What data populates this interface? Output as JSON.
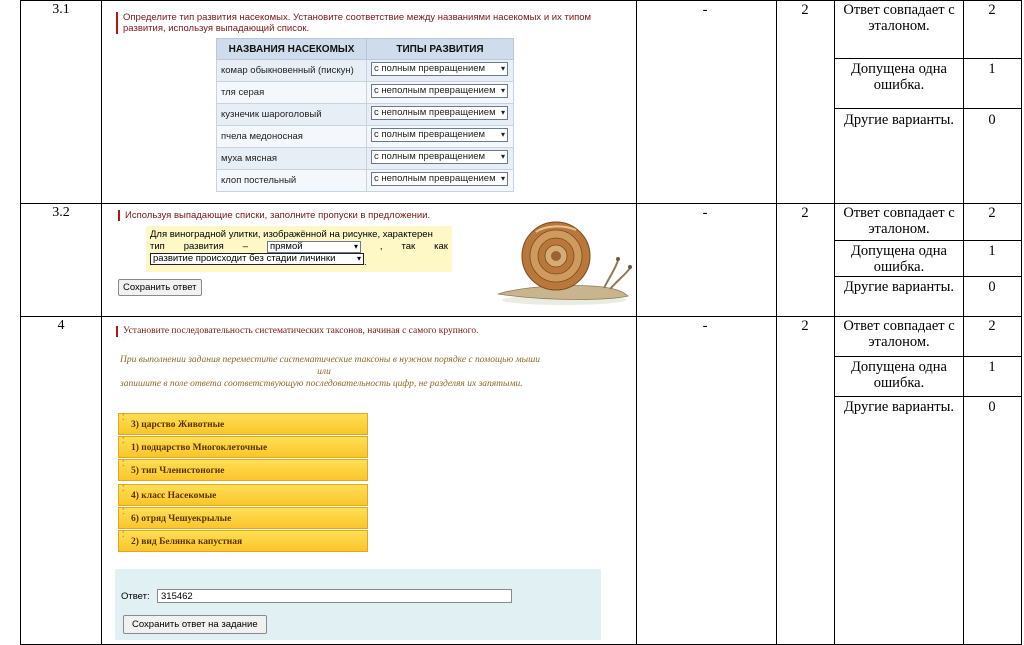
{
  "rows": [
    {
      "num": "3.1",
      "dash": "-",
      "points": "2",
      "criteria": [
        {
          "text": "Ответ совпадает с эталоном.",
          "score": "2"
        },
        {
          "text": "Допущена одна ошибка.",
          "score": "1"
        },
        {
          "text": "Другие варианты.",
          "score": "0"
        }
      ]
    },
    {
      "num": "3.2",
      "dash": "-",
      "points": "2",
      "criteria": [
        {
          "text": "Ответ совпадает с эталоном.",
          "score": "2"
        },
        {
          "text": "Допущена одна ошибка.",
          "score": "1"
        },
        {
          "text": "Другие варианты.",
          "score": "0"
        }
      ]
    },
    {
      "num": "4",
      "dash": "-",
      "points": "2",
      "criteria": [
        {
          "text": "Ответ совпадает с эталоном.",
          "score": "2"
        },
        {
          "text": "Допущена одна ошибка.",
          "score": "1"
        },
        {
          "text": "Другие варианты.",
          "score": "0"
        }
      ]
    }
  ],
  "q31": {
    "title": "Определите тип развития насекомых. Установите соответствие между названиями насекомых и их типом развития, используя выпадающий список.",
    "col1": "НАЗВАНИЯ НАСЕКОМЫХ",
    "col2": "ТИПЫ РАЗВИТИЯ",
    "items": [
      {
        "name": "комар обыкновенный (пискун)",
        "type": "с полным превращением"
      },
      {
        "name": "тля серая",
        "type": "с неполным превращением"
      },
      {
        "name": "кузнечик шароголовый",
        "type": "с неполным превращением"
      },
      {
        "name": "пчела медоносная",
        "type": "с полным превращением"
      },
      {
        "name": "муха мясная",
        "type": "с полным превращением"
      },
      {
        "name": "клоп постельный",
        "type": "с неполным превращением"
      }
    ]
  },
  "q32": {
    "title": "Используя выпадающие списки, заполните пропуски в предложении.",
    "line1": "Для виноградной улитки, изображённой на рисунке, характерен",
    "line2a": "тип",
    "line2b": "развития",
    "line2c": "–",
    "select1": "прямой",
    "line2d": ",",
    "line2e": "так",
    "line2f": "как",
    "select2": "развитие происходит без стадии личинки",
    "tail": ".",
    "save": "Сохранить ответ"
  },
  "q4": {
    "title": "Установите последовательность систематических таксонов, начиная с самого крупного.",
    "instr1": "При выполнении задания переместите систематические таксоны в нужном порядке с помощью мыши",
    "instr2": "или",
    "instr3": "запишите в поле ответа соответствующую последовательность цифр, не разделяя их запятыми.",
    "taxa": [
      "3) царство Животные",
      "1) подцарство Многоклеточные",
      "5) тип Членистоногие",
      "4) класс Насекомые",
      "6) отряд Чешуекрылые",
      "2) вид Белянка капустная"
    ],
    "answer_label": "Ответ:",
    "answer_value": "315462",
    "save": "Сохранить ответ на задание"
  }
}
